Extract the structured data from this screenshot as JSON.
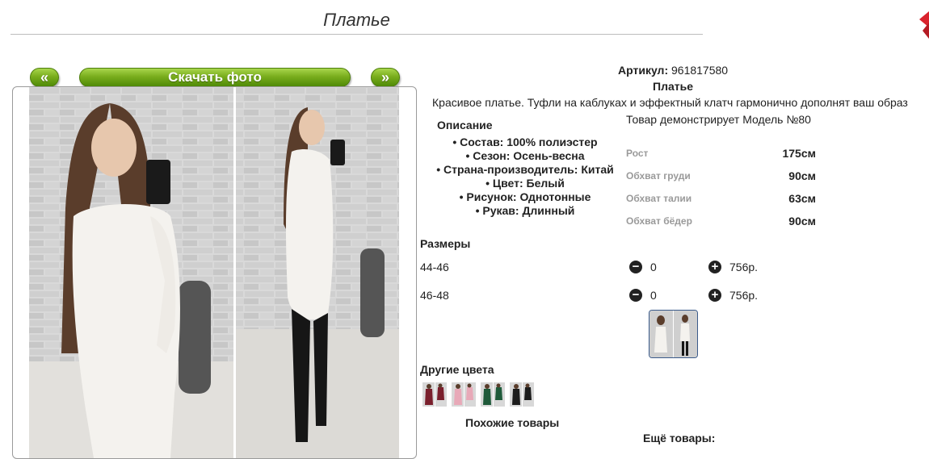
{
  "page": {
    "title": "Платье"
  },
  "gallery": {
    "prev_label": "«",
    "download_label": "Скачать фото",
    "next_label": "»"
  },
  "product": {
    "article_label": "Артикул:",
    "article_value": "961817580",
    "name": "Платье",
    "description": "Красивое платье. Туфли на каблуках и эффектный клатч гармонично дополнят ваш образ",
    "model_line": "Товар демонстрирует Модель №80",
    "description_heading": "Описание",
    "attributes": [
      "• Состав: 100% полиэстер",
      "• Сезон: Осень-весна",
      "• Страна-производитель: Китай",
      "• Цвет: Белый",
      "• Рисунок: Однотонные",
      "• Рукав: Длинный"
    ],
    "measurements": [
      {
        "label": "Рост",
        "value": "175см"
      },
      {
        "label": "Обхват груди",
        "value": "90см"
      },
      {
        "label": "Обхват талии",
        "value": "63см"
      },
      {
        "label": "Обхват бёдер",
        "value": "90см"
      }
    ]
  },
  "sizes": {
    "heading": "Размеры",
    "rows": [
      {
        "label": "44-46",
        "qty": "0",
        "price": "756р."
      },
      {
        "label": "46-48",
        "qty": "0",
        "price": "756р."
      }
    ]
  },
  "other_colors": {
    "heading": "Другие цвета",
    "items": [
      {
        "color": "#7a1f2c"
      },
      {
        "color": "#e8a9b8"
      },
      {
        "color": "#1f5a3a"
      },
      {
        "color": "#1c1c1c"
      }
    ]
  },
  "similar_heading": "Похожие товары",
  "more_heading": "Ещё товары:",
  "colors": {
    "button_green": "#79ad1d",
    "accent_red": "#d9232d",
    "dress_white": "#f4f2ee"
  }
}
